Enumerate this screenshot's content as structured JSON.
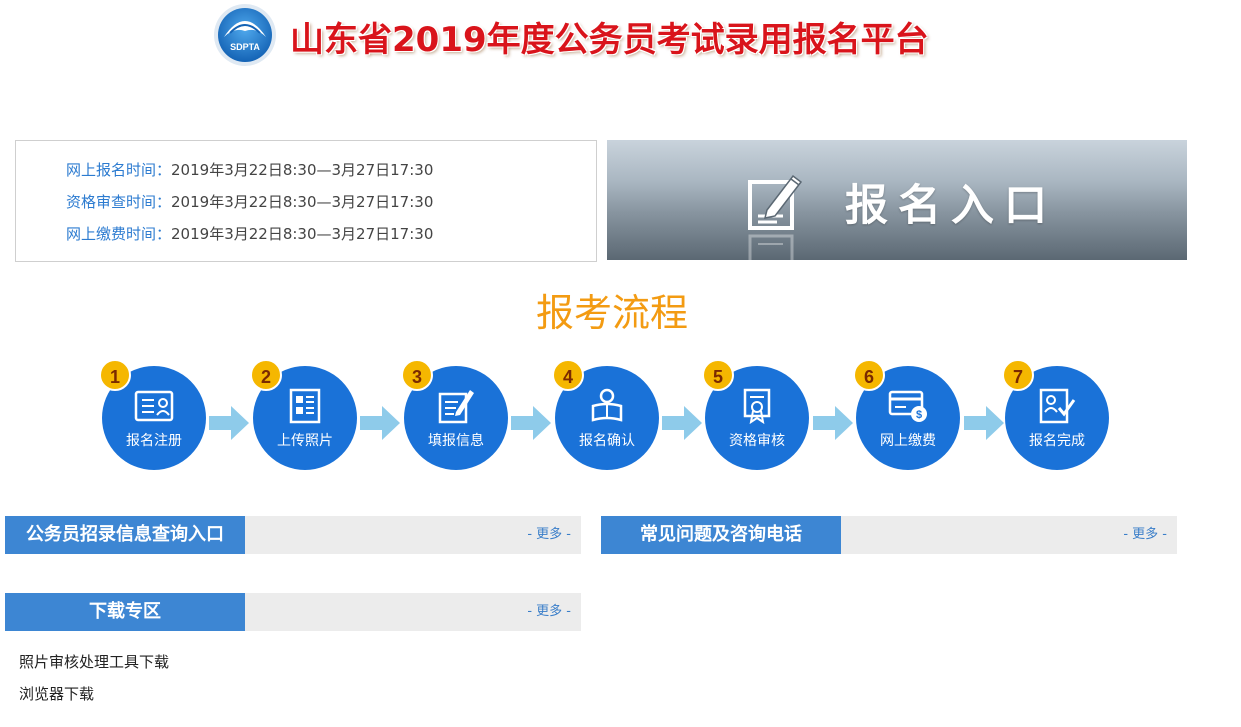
{
  "header": {
    "logo_text": "SDPTA",
    "title": "山东省2019年度公务员考试录用报名平台"
  },
  "schedule": [
    {
      "label": "网上报名时间：",
      "value": "2019年3月22日8:30—3月27日17:30"
    },
    {
      "label": "资格审查时间：",
      "value": "2019年3月22日8:30—3月27日17:30"
    },
    {
      "label": "网上缴费时间：",
      "value": "2019年3月22日8:30—3月27日17:30"
    }
  ],
  "register_banner": {
    "label": "报名入口",
    "icon": "edit-document-icon"
  },
  "process": {
    "title": "报考流程",
    "steps": [
      {
        "num": "1",
        "label": "报名注册",
        "icon": "id-card-icon"
      },
      {
        "num": "2",
        "label": "上传照片",
        "icon": "photo-list-icon"
      },
      {
        "num": "3",
        "label": "填报信息",
        "icon": "form-pen-icon"
      },
      {
        "num": "4",
        "label": "报名确认",
        "icon": "person-book-icon"
      },
      {
        "num": "5",
        "label": "资格审核",
        "icon": "certificate-icon"
      },
      {
        "num": "6",
        "label": "网上缴费",
        "icon": "card-payment-icon"
      },
      {
        "num": "7",
        "label": "报名完成",
        "icon": "user-check-icon"
      }
    ]
  },
  "sections": {
    "query": {
      "title": "公务员招录信息查询入口",
      "more": "- 更多 -"
    },
    "faq": {
      "title": "常见问题及咨询电话",
      "more": "- 更多 -"
    },
    "download": {
      "title": "下载专区",
      "more": "- 更多 -",
      "links": [
        "照片审核处理工具下载",
        "浏览器下载"
      ]
    }
  },
  "colors": {
    "title_red": "#d9141b",
    "accent_blue": "#1a72d8",
    "section_blue": "#3d86d3",
    "process_orange": "#f39b12",
    "step_badge": "#f5b700",
    "arrow": "#8ecbea"
  }
}
